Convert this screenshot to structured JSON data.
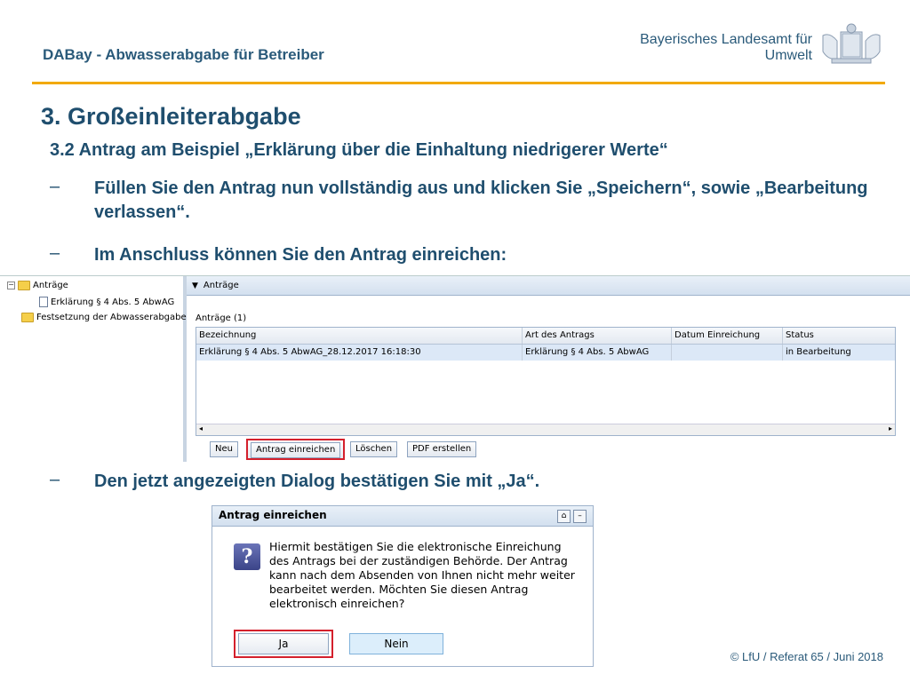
{
  "header": {
    "title": "DABay - Abwasserabgabe für Betreiber",
    "agency_line1": "Bayerisches Landesamt für",
    "agency_line2": "Umwelt"
  },
  "slide": {
    "title": "3. Großeinleiterabgabe",
    "subtitle": "3.2 Antrag am Beispiel „Erklärung über die Einhaltung niedrigerer Werte“",
    "dash": "–",
    "bullets": [
      "Füllen Sie den Antrag nun vollständig aus und klicken Sie „Speichern“, sowie „Bearbeitung verlassen“.",
      "Im Anschluss können Sie den Antrag einreichen:",
      "Den jetzt angezeigten Dialog bestätigen Sie mit „Ja“."
    ]
  },
  "app": {
    "tree": {
      "expander": "−",
      "items": [
        {
          "label": "Anträge",
          "icon": "folder-icon"
        },
        {
          "label": "Erklärung § 4 Abs. 5 AbwAG",
          "icon": "document-icon"
        },
        {
          "label": "Festsetzung der Abwasserabgabe",
          "icon": "folder-icon"
        }
      ]
    },
    "panel": {
      "header": "Anträge",
      "section_label": "Anträge (1)",
      "columns": [
        "Bezeichnung",
        "Art des Antrags",
        "Datum Einreichung",
        "Status"
      ],
      "rows": [
        [
          "Erklärung § 4 Abs. 5 AbwAG_28.12.2017 16:18:30",
          "Erklärung § 4 Abs. 5 AbwAG",
          "",
          "in Bearbeitung"
        ]
      ],
      "buttons": {
        "new": "Neu",
        "submit": "Antrag einreichen",
        "delete": "Löschen",
        "pdf": "PDF erstellen"
      },
      "scroll_left": "◂",
      "scroll_right": "▸"
    }
  },
  "dialog": {
    "title": "Antrag einreichen",
    "icon_glyph": "?",
    "message": "Hiermit bestätigen Sie die elektronische Einreichung des Antrags bei der zuständigen Behörde. Der Antrag kann nach dem Absenden von Ihnen nicht mehr weiter bearbeitet werden. Möchten Sie diesen Antrag elektronisch einreichen?",
    "yes": "Ja",
    "no": "Nein",
    "minimize_glyph": "–"
  },
  "footer": {
    "text": "© LfU / Referat 65 / Juni 2018"
  },
  "colors": {
    "accent_rule": "#f2a900",
    "text_primary": "#1f4e6e",
    "highlight_box": "#d4202c"
  }
}
